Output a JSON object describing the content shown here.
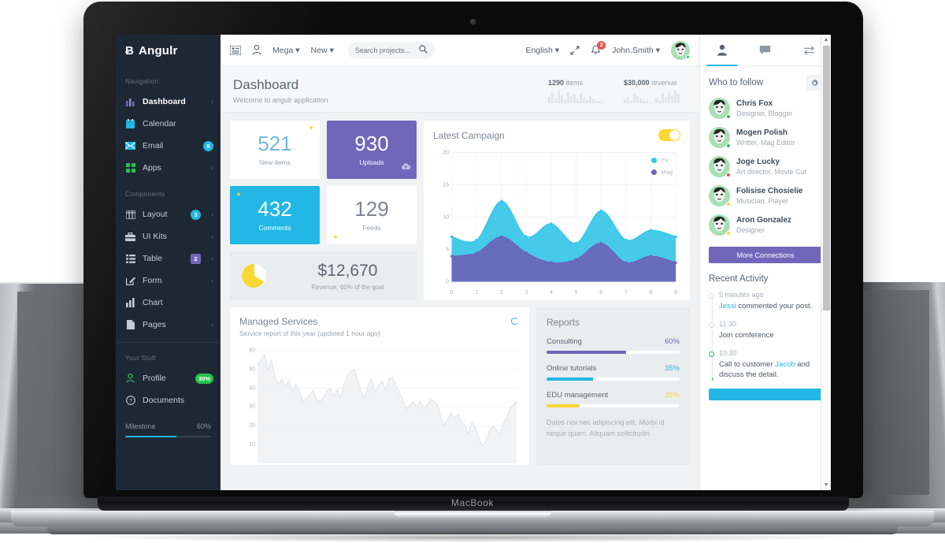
{
  "device": {
    "brand_label": "MacBook"
  },
  "sidebar": {
    "brand": {
      "mark": "Ƀ",
      "name": "Angulr"
    },
    "sections": [
      {
        "heading": "Navigation",
        "items": [
          {
            "label": "Dashboard",
            "icon": "bar-chart-icon",
            "badge": null,
            "caret": true,
            "active": true
          },
          {
            "label": "Calendar",
            "icon": "calendar-icon",
            "badge": null,
            "caret": false,
            "active": false
          },
          {
            "label": "Email",
            "icon": "envelope-icon",
            "badge": "9",
            "badge_color": "blue",
            "caret": false,
            "active": false
          },
          {
            "label": "Apps",
            "icon": "grid-icon",
            "badge": null,
            "caret": true,
            "active": false
          }
        ]
      },
      {
        "heading": "Components",
        "items": [
          {
            "label": "Layout",
            "icon": "columns-icon",
            "badge": "3",
            "badge_color": "blue",
            "caret": true
          },
          {
            "label": "UI Kits",
            "icon": "briefcase-icon",
            "badge": null,
            "caret": true
          },
          {
            "label": "Table",
            "icon": "list-icon",
            "badge": "2",
            "badge_color": "purple",
            "caret": true
          },
          {
            "label": "Form",
            "icon": "edit-icon",
            "badge": null,
            "caret": true
          },
          {
            "label": "Chart",
            "icon": "bar-chart-icon",
            "badge": null,
            "caret": false
          },
          {
            "label": "Pages",
            "icon": "file-icon",
            "badge": null,
            "caret": true
          }
        ]
      },
      {
        "heading": "Your Stuff",
        "items": [
          {
            "label": "Profile",
            "icon": "user-icon",
            "badge": "30%",
            "badge_color": "green",
            "caret": false
          },
          {
            "label": "Documents",
            "icon": "question-circle-icon",
            "badge": null,
            "caret": false
          }
        ]
      }
    ],
    "milestone": {
      "label": "Milestone",
      "value": "60%",
      "percent": 60
    }
  },
  "topbar": {
    "menu_icon": "menu-list-icon",
    "user_icon": "user-outline-icon",
    "mega_label": "Mega",
    "new_label": "New",
    "search_placeholder": "Search projects...",
    "search_value": "",
    "search_icon": "search-icon",
    "language_label": "English",
    "fullscreen_icon": "expand-icon",
    "bell_icon": "bell-icon",
    "bell_count": "2",
    "user_name": "John.Smith"
  },
  "page": {
    "title": "Dashboard",
    "subtitle": "Welcome to angulr application",
    "stats": [
      {
        "value": "1290",
        "label": "items"
      },
      {
        "value": "$30,000",
        "label": "revenue"
      }
    ],
    "spark_items": [
      6,
      10,
      5,
      12,
      8,
      4,
      11,
      7,
      9,
      5,
      10,
      6,
      3,
      7,
      4,
      2,
      2,
      1
    ],
    "spark_revenue": [
      4,
      6,
      3,
      9,
      7,
      5,
      2,
      2,
      1,
      1,
      5,
      3,
      10,
      6,
      11,
      8,
      12,
      9
    ]
  },
  "tiles": [
    {
      "number": "521",
      "label": "New items",
      "style": "white",
      "marker": "caret-down",
      "marker_color": "#fad733"
    },
    {
      "number": "930",
      "label": "Uploads",
      "style": "purple",
      "marker": null,
      "icon": "cloud-upload-icon"
    },
    {
      "number": "432",
      "label": "Comments",
      "style": "cyan",
      "marker": "caret-up",
      "marker_color": "#fad733"
    },
    {
      "number": "129",
      "label": "Feeds",
      "style": "white",
      "marker": "caret-up",
      "marker_color": "#fad733"
    }
  ],
  "revenue_card": {
    "amount": "$12,670",
    "caption": "Revenue, 60% of the goal",
    "pie_percent": 60,
    "pie_color": "#fad733"
  },
  "campaign": {
    "title": "Latest Campaign",
    "toggle_on": true,
    "toggle_color": "#fad733"
  },
  "managed": {
    "title": "Managed Services",
    "subtitle": "Service report of this year (updated 1 hour ago)",
    "loader_icon": "spinner-icon"
  },
  "reports": {
    "title": "Reports",
    "items": [
      {
        "label": "Consulting",
        "value": "60%",
        "percent": 60,
        "color": "#7266ba"
      },
      {
        "label": "Online tutorials",
        "value": "35%",
        "percent": 35,
        "color": "#23b7e5"
      },
      {
        "label": "EDU management",
        "value": "25%",
        "percent": 25,
        "color": "#fad733"
      }
    ],
    "note": "Dales nisi nec adipiscing elit. Morbi id neque quam. Aliquam sollicitudin"
  },
  "right_panel": {
    "tabs": [
      {
        "icon": "user-icon",
        "active": true
      },
      {
        "icon": "comment-icon",
        "active": false
      },
      {
        "icon": "transfer-icon",
        "active": false
      }
    ],
    "who_to_follow": {
      "title": "Who to follow",
      "gear_icon": "gear-icon",
      "people": [
        {
          "name": "Chris Fox",
          "role": "Designer, Blogger",
          "status_color": "#27c24c"
        },
        {
          "name": "Mogen Polish",
          "role": "Writter, Mag Editor",
          "status_color": "#27c24c"
        },
        {
          "name": "Joge Lucky",
          "role": "Art director, Movie Cut",
          "status_color": "#f05050"
        },
        {
          "name": "Folisise Chosielie",
          "role": "Musician, Player",
          "status_color": "#fad733"
        },
        {
          "name": "Aron Gonzalez",
          "role": "Designer",
          "status_color": "#fad733"
        }
      ],
      "more_button": "More Connections"
    },
    "recent_activity": {
      "title": "Recent Activity",
      "items": [
        {
          "time": "5 minutes ago",
          "text_before": "",
          "link": "Jessi",
          "text_after": " commented your post.",
          "dot": "gray"
        },
        {
          "time": "11:30",
          "text_before": "Join comference",
          "link": "",
          "text_after": "",
          "dot": "gray"
        },
        {
          "time": "10:30",
          "text_before": "Call to customer ",
          "link": "Jacob",
          "text_after": " and discuss the detail.",
          "dot": "green"
        }
      ]
    }
  },
  "chart_data": [
    {
      "type": "area",
      "title": "Latest Campaign",
      "x": [
        0,
        1,
        2,
        3,
        4,
        5,
        6,
        7,
        8,
        9
      ],
      "series": [
        {
          "name": "TV",
          "color": "#36c6e8",
          "values": [
            7,
            6.5,
            12.5,
            7,
            9,
            6,
            11,
            6.5,
            8,
            7
          ]
        },
        {
          "name": "Mag",
          "color": "#6b64b8",
          "values": [
            4,
            4.5,
            7,
            4.5,
            3,
            3.5,
            6,
            3,
            4,
            3
          ]
        }
      ],
      "xlabel": "",
      "ylabel": "",
      "ylim": [
        0,
        20
      ],
      "yticks": [
        0,
        5,
        10,
        15,
        20
      ],
      "xticks": [
        0,
        1,
        2,
        3,
        4,
        5,
        6,
        7,
        8,
        9
      ],
      "grid": true,
      "legend_position": "top-right",
      "stacked": true
    },
    {
      "type": "area",
      "title": "Managed Services",
      "subtitle": "Service report of this year (updated 1 hour ago)",
      "ylim": [
        0,
        62
      ],
      "yticks": [
        10,
        20,
        30,
        40,
        50,
        60
      ],
      "grid": true,
      "legend_position": "none",
      "series": [
        {
          "name": "Services",
          "color": "#e9edf0",
          "values": [
            52,
            55,
            58,
            50,
            55,
            46,
            42,
            45,
            41,
            44,
            38,
            42,
            39,
            33,
            34,
            36,
            39,
            34,
            33,
            35,
            38,
            40,
            36,
            39,
            35,
            42,
            47,
            49,
            50,
            44,
            38,
            35,
            42,
            45,
            38,
            41,
            44,
            39,
            45,
            46,
            41,
            38,
            34,
            29,
            31,
            33,
            30,
            33,
            29,
            31,
            34,
            33,
            31,
            25,
            20,
            24,
            27,
            24,
            26,
            22,
            20,
            16,
            22,
            19,
            14,
            9,
            12,
            17,
            20,
            18,
            15,
            21,
            25,
            29,
            31,
            33
          ]
        }
      ]
    }
  ]
}
